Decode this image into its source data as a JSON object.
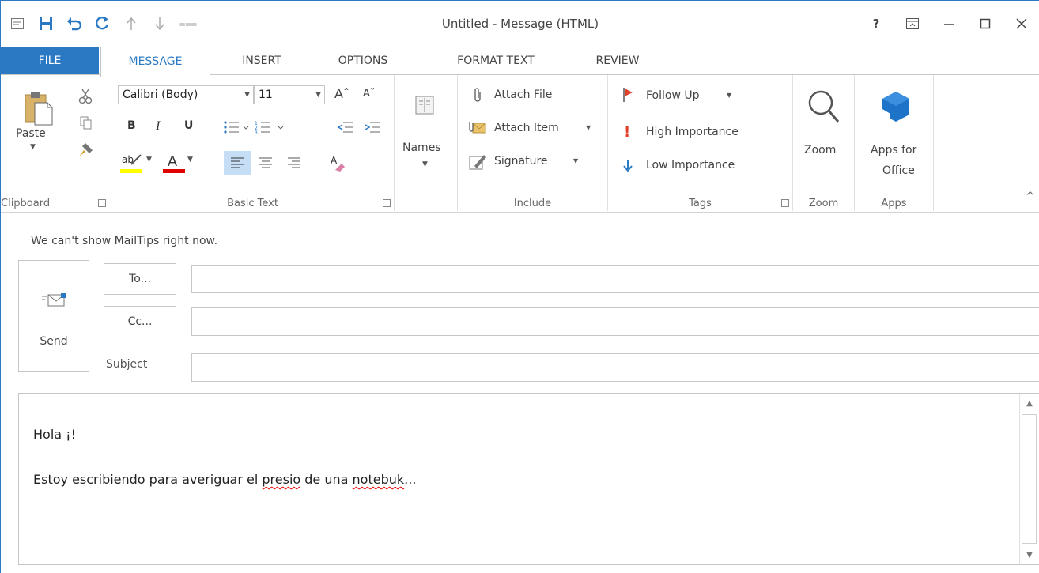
{
  "window": {
    "title": "Untitled - Message (HTML)"
  },
  "qat": {
    "customize_glyph": "⩶"
  },
  "window_controls": {
    "help": "?",
    "restore_ribbon": "▣",
    "minimize": "—",
    "maximize": "☐",
    "close": "✕"
  },
  "tabs": [
    {
      "label": "FILE"
    },
    {
      "label": "MESSAGE"
    },
    {
      "label": "INSERT"
    },
    {
      "label": "OPTIONS"
    },
    {
      "label": "FORMAT TEXT"
    },
    {
      "label": "REVIEW"
    }
  ],
  "ribbon": {
    "clipboard": {
      "label": "Clipboard",
      "paste": "Paste"
    },
    "basic_text": {
      "label": "Basic Text",
      "font": "Calibri (Body)",
      "size": "11",
      "bold": "B",
      "italic": "I",
      "underline": "U",
      "grow": "Aˆ",
      "shrink": "Aˇ",
      "highlight": "ab",
      "font_color": "A"
    },
    "names": {
      "label": "Names"
    },
    "include": {
      "label": "Include",
      "attach_file": "Attach File",
      "attach_item": "Attach Item",
      "signature": "Signature"
    },
    "tags": {
      "label": "Tags",
      "follow_up": "Follow Up",
      "high": "High Importance",
      "low": "Low Importance"
    },
    "zoom": {
      "label": "Zoom",
      "button": "Zoom"
    },
    "apps": {
      "label": "Apps",
      "button_line1": "Apps for",
      "button_line2": "Office"
    },
    "collapse": "^"
  },
  "mail": {
    "mailtips": "We can't show MailTips right now.",
    "send": "Send",
    "to": "To...",
    "cc": "Cc...",
    "subject_label": "Subject",
    "to_value": "",
    "cc_value": "",
    "subject_value": ""
  },
  "body": {
    "line1": "Hola ¡!",
    "line2_a": "Estoy escribiendo para averiguar el ",
    "line2_miss1": "presio",
    "line2_b": " de una ",
    "line2_miss2": "notebuk",
    "line2_c": "..."
  },
  "colors": {
    "accent": "#2b79c3",
    "highlight": "#ffff00",
    "font_color": "#e00000",
    "flag": "#e0412b",
    "apps": "#1c73c7"
  }
}
